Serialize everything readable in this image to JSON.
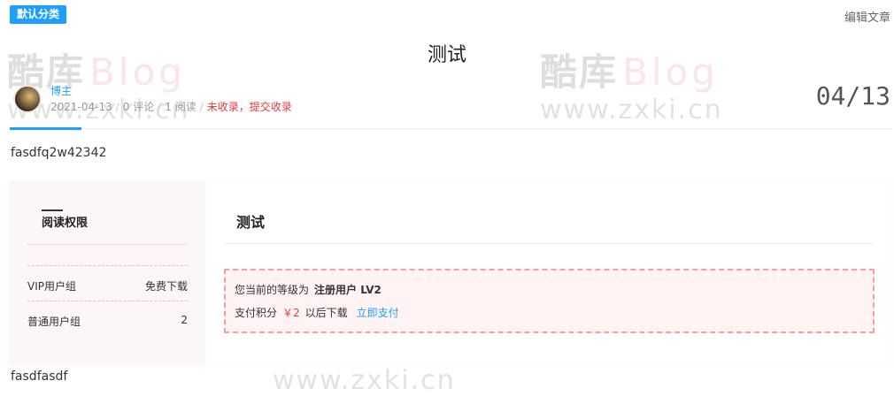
{
  "category_badge": "默认分类",
  "edit_link": "编辑文章",
  "title": "测试",
  "author": "博主",
  "meta": {
    "date": "2021-04-13",
    "comments": "0 评论",
    "reads": "1 阅读",
    "index_status": "未收录，提交收录"
  },
  "date_big": "04/13",
  "content": {
    "line1": "fasdfq2w42342",
    "line2": "fasdfasdf"
  },
  "permission": {
    "title": "阅读权限",
    "rows": [
      {
        "name": "VIP用户组",
        "value": "免费下载"
      },
      {
        "name": "普通用户组",
        "value": "2"
      }
    ]
  },
  "purchase": {
    "title": "测试",
    "level_text": "您当前的等级为",
    "level_value": "注册用户 LV2",
    "pay_text": "支付积分",
    "price": "￥2",
    "after_text": "以后下载",
    "pay_link": "立即支付"
  },
  "watermark": {
    "brand_cn": "酷库",
    "brand_en": "Blog",
    "url": "www.zxki.cn"
  },
  "colors": {
    "accent": "#1e9fff",
    "warn": "#e4393c",
    "notice_border": "#f2a0a0"
  }
}
